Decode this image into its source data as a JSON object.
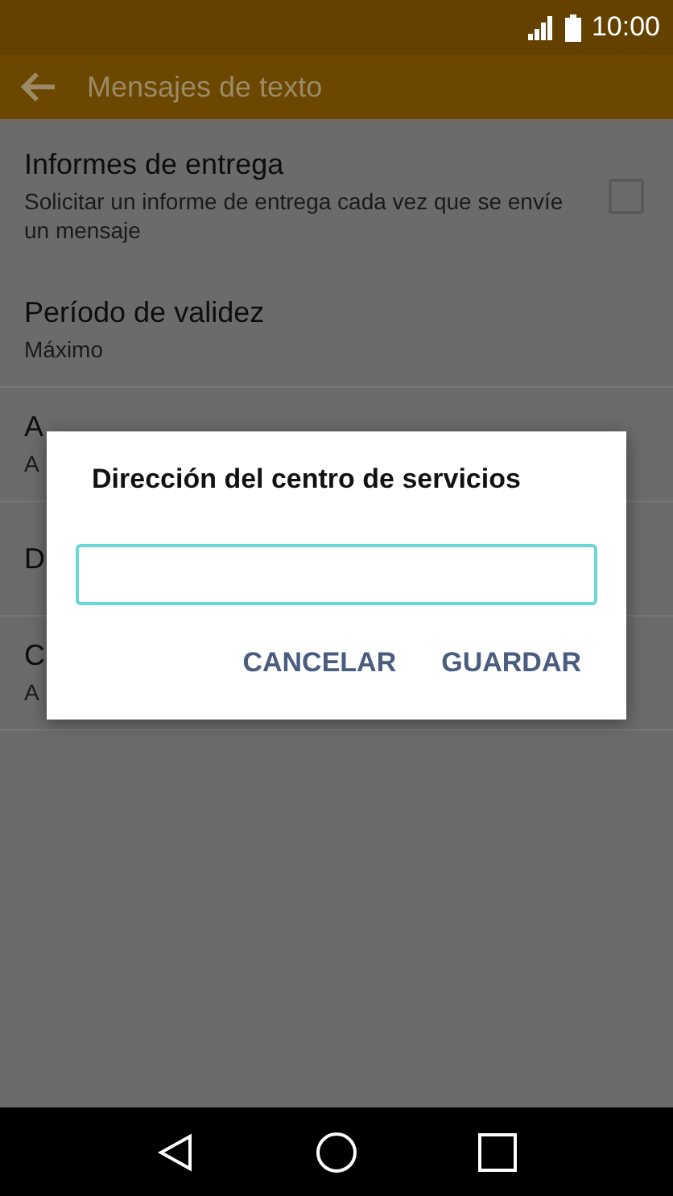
{
  "status_bar": {
    "time": "10:00"
  },
  "app_bar": {
    "title": "Mensajes de texto"
  },
  "settings": [
    {
      "kind": "checkbox",
      "title": "Informes de entrega",
      "subtitle": "Solicitar un informe de entrega cada vez que se envíe un mensaje",
      "checked": false
    },
    {
      "kind": "plain",
      "title": "Período de validez",
      "subtitle": "Máximo"
    },
    {
      "kind": "plain",
      "title": "A",
      "subtitle": "A"
    },
    {
      "kind": "plain",
      "title": "D"
    },
    {
      "kind": "plain",
      "title": "C",
      "subtitle": "A"
    }
  ],
  "dialog": {
    "title": "Dirección del centro de servicios",
    "buttons": [
      "CANCELAR",
      "GUARDAR"
    ]
  }
}
